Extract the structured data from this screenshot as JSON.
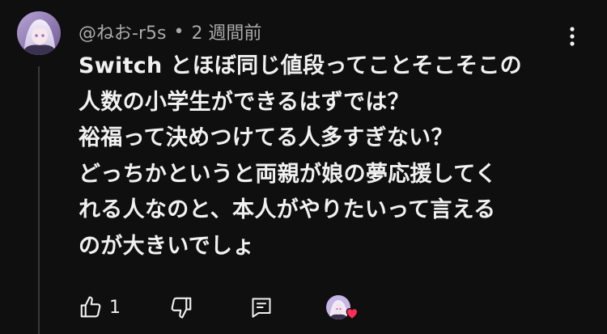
{
  "comment": {
    "author": "@ねお-r5s",
    "separator": "•",
    "timestamp": "2 週間前",
    "lines": [
      "Switch とほぼ同じ値段ってことそこそこの",
      "人数の小学生ができるはずでは？",
      "裕福って決めつけてる人多すぎない？",
      "どっちかというと両親が娘の夢応援してく",
      "れる人なのと、本人がやりたいって言える",
      "のが大きいでしょ"
    ]
  },
  "actions": {
    "like_count": "1",
    "like_icon": "thumbs-up-icon",
    "dislike_icon": "thumbs-down-icon",
    "reply_icon": "reply-icon",
    "hearted_icon": "heart-icon"
  },
  "colors": {
    "background": "#0f0f0f",
    "text": "#f1f1f1",
    "secondary_text": "#aaaaaa",
    "heart": "#ff2d55"
  }
}
